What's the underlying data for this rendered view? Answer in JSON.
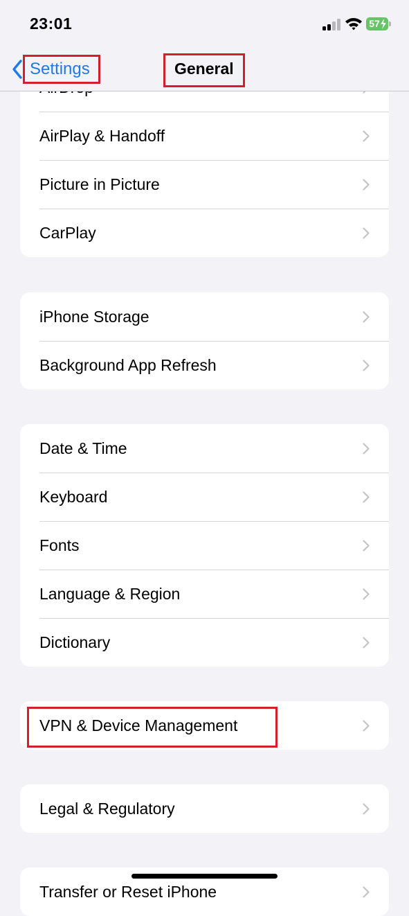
{
  "status_bar": {
    "time": "23:01",
    "battery_level": "57"
  },
  "nav": {
    "back_label": "Settings",
    "title": "General"
  },
  "groups": [
    {
      "rows": [
        {
          "label": "AirDrop"
        },
        {
          "label": "AirPlay & Handoff"
        },
        {
          "label": "Picture in Picture"
        },
        {
          "label": "CarPlay"
        }
      ]
    },
    {
      "rows": [
        {
          "label": "iPhone Storage"
        },
        {
          "label": "Background App Refresh"
        }
      ]
    },
    {
      "rows": [
        {
          "label": "Date & Time"
        },
        {
          "label": "Keyboard"
        },
        {
          "label": "Fonts"
        },
        {
          "label": "Language & Region"
        },
        {
          "label": "Dictionary"
        }
      ]
    },
    {
      "rows": [
        {
          "label": "VPN & Device Management"
        }
      ]
    },
    {
      "rows": [
        {
          "label": "Legal & Regulatory"
        }
      ]
    },
    {
      "rows": [
        {
          "label": "Transfer or Reset iPhone"
        }
      ]
    }
  ],
  "colors": {
    "accent": "#1f7ae8",
    "highlight": "#d1202c",
    "background": "#f2f2f7",
    "battery": "#65c466"
  }
}
